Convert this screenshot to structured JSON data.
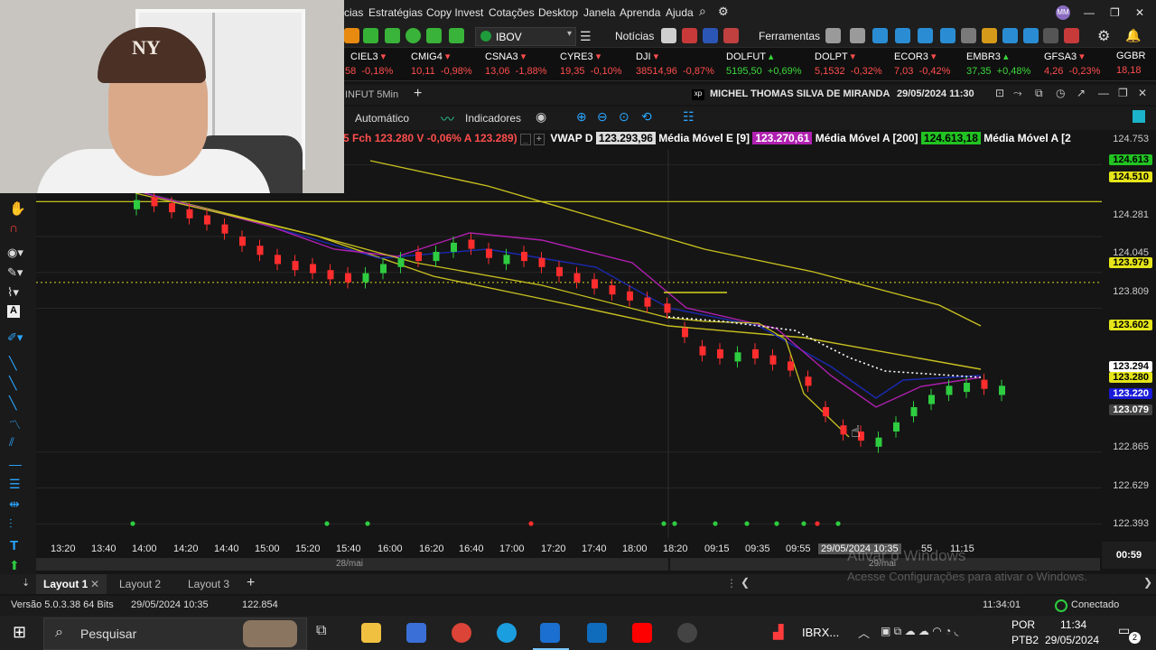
{
  "menu": [
    "cias",
    "Estratégias",
    "Copy Invest",
    "Cotações",
    "Desktop",
    "Janela",
    "Aprenda",
    "Ajuda"
  ],
  "toolbar": {
    "asset": "IBOV",
    "news": "Notícias",
    "tools": "Ferramentas"
  },
  "tickers": [
    {
      "symbol": "CIEL3",
      "left": "58",
      "pct": "-0,18%",
      "dir": "neg"
    },
    {
      "symbol": "CMIG4",
      "left": "10,11",
      "pct": "-0,98%",
      "dir": "neg"
    },
    {
      "symbol": "CSNA3",
      "left": "13,06",
      "pct": "-1,88%",
      "dir": "neg"
    },
    {
      "symbol": "CYRE3",
      "left": "19,35",
      "pct": "-0,10%",
      "dir": "neg"
    },
    {
      "symbol": "DJI",
      "left": "38514,96",
      "pct": "-0,87%",
      "dir": "neg"
    },
    {
      "symbol": "DOLFUT",
      "left": "5195,50",
      "pct": "+0,69%",
      "dir": "pos"
    },
    {
      "symbol": "DOLPT",
      "left": "5,1532",
      "pct": "-0,32%",
      "dir": "neg"
    },
    {
      "symbol": "ECOR3",
      "left": "7,03",
      "pct": "-0,42%",
      "dir": "neg"
    },
    {
      "symbol": "EMBR3",
      "left": "37,35",
      "pct": "+0,48%",
      "dir": "pos"
    },
    {
      "symbol": "GFSA3",
      "left": "4,26",
      "pct": "-0,23%",
      "dir": "neg"
    },
    {
      "symbol": "GGBR",
      "left": "18,18",
      "pct": "-",
      "dir": "neg"
    }
  ],
  "chart_window": {
    "tab_label": "INFUT 5Min",
    "user": "MICHEL THOMAS SILVA DE MIRANDA",
    "datetime": "29/05/2024 11:30",
    "auto": "Automático",
    "indicators": "Indicadores"
  },
  "indicator_bar": {
    "fch_label": "5 Fch",
    "fch_value": "123.280",
    "v_label": "V",
    "v_value": "-0,06%",
    "a_label": "A",
    "a_value": "123.289)",
    "vwap_label": "VWAP D",
    "vwap_value": "123.293,96",
    "mme_label": "Média Móvel E [9]",
    "mme_value": "123.270,61",
    "mma_label": "Média Móvel A [200]",
    "mma_value": "124.613,18",
    "mma2_label": "Média Móvel A [2"
  },
  "yaxis": {
    "ticks": [
      "124.753",
      "124.281",
      "124.045",
      "123.809",
      "122.865",
      "122.629",
      "122.393"
    ],
    "tags": [
      {
        "text": "124.613",
        "bg": "#22c322",
        "fg": "#000"
      },
      {
        "text": "124.510",
        "bg": "#e5e51a",
        "fg": "#000"
      },
      {
        "text": "123.979",
        "bg": "#e5e51a",
        "fg": "#000"
      },
      {
        "text": "123.602",
        "bg": "#e5e51a",
        "fg": "#000"
      },
      {
        "text": "123.294",
        "bg": "#ffffff",
        "fg": "#000"
      },
      {
        "text": "123.280",
        "bg": "#e5e51a",
        "fg": "#000"
      },
      {
        "text": "123.220",
        "bg": "#1a1ad8",
        "fg": "#fff"
      },
      {
        "text": "123.079",
        "bg": "#444444",
        "fg": "#fff"
      }
    ],
    "countdown": "00:59"
  },
  "xaxis": {
    "ticks": [
      "13:20",
      "13:40",
      "14:00",
      "14:20",
      "14:40",
      "15:00",
      "15:20",
      "15:40",
      "16:00",
      "16:20",
      "16:40",
      "17:00",
      "17:20",
      "17:40",
      "18:00",
      "18:20",
      "09:15",
      "09:35",
      "09:55"
    ],
    "cursor_label": "29/05/2024 10:35",
    "tail": [
      "55",
      "11:15"
    ],
    "date1": "28/mai",
    "date2": "29/mai"
  },
  "chart_data": {
    "type": "candlestick",
    "ylim": [
      122.3,
      124.85
    ],
    "ylabel_ticks": [
      124.753,
      124.281,
      124.045,
      123.809,
      122.865,
      122.629,
      122.393
    ],
    "levels": {
      "yellow_line": 124.51,
      "dotted_line": 123.979
    }
  },
  "layouts": [
    "Layout 1",
    "Layout 2",
    "Layout 3"
  ],
  "status": {
    "version": "Versão 5.0.3.38 64 Bits",
    "date": "29/05/2024 10:35",
    "price": "122.854",
    "time": "11:34:01",
    "conn": "Conectado"
  },
  "watermark": {
    "line1": "Ativar o Windows",
    "line2": "Acesse Configurações para ativar o Windows."
  },
  "taskbar": {
    "search": "Pesquisar",
    "ibrx": "IBRX...",
    "lang1": "POR",
    "lang2": "PTB2",
    "clock": "11:34",
    "date": "29/05/2024",
    "notif": "2"
  },
  "colors": {
    "up": "#2ecc40",
    "down": "#ff2d2d",
    "ma_yellow": "#c8c020",
    "ma_magenta": "#b020b0",
    "ma_blue": "#1a2ab0",
    "vwap": "#ffffff"
  }
}
